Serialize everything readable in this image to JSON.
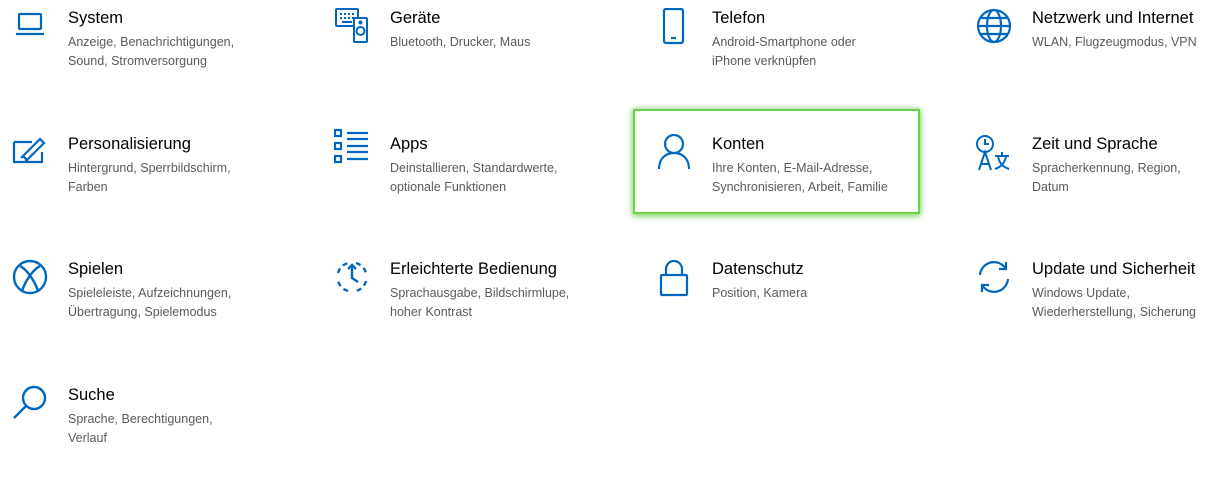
{
  "colors": {
    "accent": "#0067c0",
    "highlight": "#6ad24a",
    "title_text": "#000000",
    "desc_text": "#5a5a5a"
  },
  "tiles": [
    {
      "key": "system",
      "icon": "laptop-icon",
      "title": "System",
      "desc": [
        "Anzeige, Benachrichtigungen,",
        "Sound, Stromversorgung"
      ]
    },
    {
      "key": "geraete",
      "icon": "keyboard-speaker-icon",
      "title": "Geräte",
      "desc": [
        "Bluetooth, Drucker, Maus"
      ]
    },
    {
      "key": "telefon",
      "icon": "phone-icon",
      "title": "Telefon",
      "desc": [
        "Android-Smartphone oder",
        "iPhone verknüpfen"
      ]
    },
    {
      "key": "netzwerk",
      "icon": "globe-icon",
      "title": "Netzwerk und Internet",
      "desc": [
        "WLAN, Flugzeugmodus, VPN"
      ]
    },
    {
      "key": "personalisierung",
      "icon": "paint-brush-icon",
      "title": "Personalisierung",
      "desc": [
        "Hintergrund, Sperrbildschirm,",
        "Farben"
      ]
    },
    {
      "key": "apps",
      "icon": "apps-list-icon",
      "title": "Apps",
      "desc": [
        "Deinstallieren, Standardwerte,",
        "optionale Funktionen"
      ]
    },
    {
      "key": "konten",
      "icon": "person-icon",
      "title": "Konten",
      "desc": [
        "Ihre Konten, E-Mail-Adresse,",
        "Synchronisieren, Arbeit, Familie"
      ],
      "highlighted": true
    },
    {
      "key": "zeit",
      "icon": "time-language-icon",
      "title": "Zeit und Sprache",
      "desc": [
        "Spracherkennung, Region,",
        "Datum"
      ]
    },
    {
      "key": "spielen",
      "icon": "xbox-icon",
      "title": "Spielen",
      "desc": [
        "Spieleleiste, Aufzeichnungen,",
        "Übertragung, Spielemodus"
      ]
    },
    {
      "key": "bedienung",
      "icon": "ease-of-access-icon",
      "title": "Erleichterte Bedienung",
      "desc": [
        "Sprachausgabe, Bildschirmlupe,",
        "hoher Kontrast"
      ]
    },
    {
      "key": "datenschutz",
      "icon": "lock-icon",
      "title": "Datenschutz",
      "desc": [
        "Position, Kamera"
      ]
    },
    {
      "key": "update",
      "icon": "sync-icon",
      "title": "Update und Sicherheit",
      "desc": [
        "Windows Update,",
        "Wiederherstellung, Sicherung"
      ]
    },
    {
      "key": "suche",
      "icon": "search-icon",
      "title": "Suche",
      "desc": [
        "Sprache, Berechtigungen,",
        "Verlauf"
      ]
    }
  ]
}
